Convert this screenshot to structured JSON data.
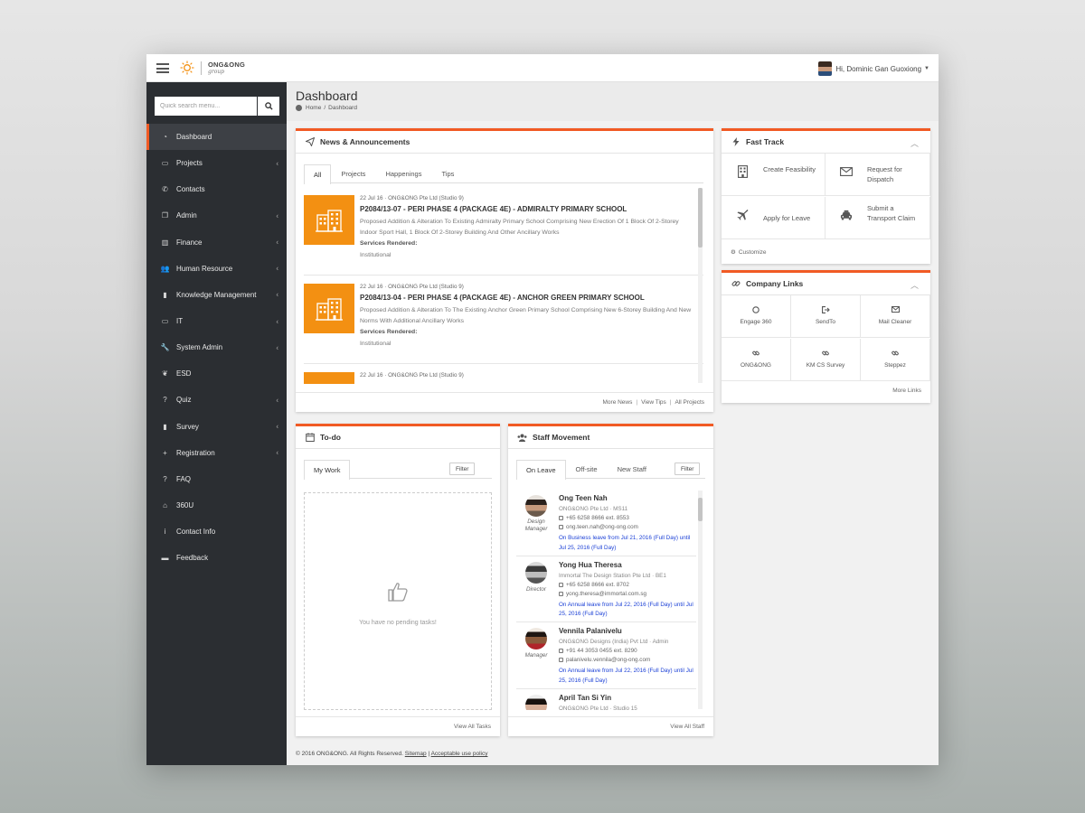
{
  "topbar": {
    "logo_text": "ONG&ONG",
    "logo_sub": "group",
    "user_greeting": "Hi, Dominic Gan Guoxiong"
  },
  "sidebar": {
    "search_placeholder": "Quick search menu...",
    "items": [
      {
        "label": "Dashboard",
        "icon": "dashboard-icon",
        "active": true,
        "chevron": false
      },
      {
        "label": "Projects",
        "icon": "folder-icon",
        "chevron": true
      },
      {
        "label": "Contacts",
        "icon": "phone-icon",
        "chevron": false
      },
      {
        "label": "Admin",
        "icon": "copy-icon",
        "chevron": true
      },
      {
        "label": "Finance",
        "icon": "bar-chart-icon",
        "chevron": true
      },
      {
        "label": "Human Resource",
        "icon": "users-icon",
        "chevron": true
      },
      {
        "label": "Knowledge Management",
        "icon": "book-icon",
        "chevron": true
      },
      {
        "label": "IT",
        "icon": "laptop-icon",
        "chevron": true
      },
      {
        "label": "System Admin",
        "icon": "wrench-icon",
        "chevron": true
      },
      {
        "label": "ESD",
        "icon": "leaf-icon",
        "chevron": false
      },
      {
        "label": "Quiz",
        "icon": "question-circle-icon",
        "chevron": true
      },
      {
        "label": "Survey",
        "icon": "book-icon",
        "chevron": true
      },
      {
        "label": "Registration",
        "icon": "plus-icon",
        "chevron": true
      },
      {
        "label": "FAQ",
        "icon": "question-icon",
        "chevron": false
      },
      {
        "label": "360U",
        "icon": "bank-icon",
        "chevron": false
      },
      {
        "label": "Contact Info",
        "icon": "info-circle-icon",
        "chevron": false
      },
      {
        "label": "Feedback",
        "icon": "comments-icon",
        "chevron": false
      }
    ]
  },
  "header": {
    "title": "Dashboard",
    "breadcrumb_home": "Home",
    "breadcrumb_sep": "/",
    "breadcrumb_current": "Dashboard"
  },
  "news": {
    "title": "News & Announcements",
    "tabs": [
      "All",
      "Projects",
      "Happenings",
      "Tips"
    ],
    "items": [
      {
        "meta": "22 Jul 16  ·  ONG&ONG Pte Ltd (Studio 9)",
        "title": "P2084/13-07 - PERI PHASE 4 (PACKAGE 4E) - ADMIRALTY PRIMARY SCHOOL",
        "desc": "Proposed Addition & Alteration To Existing Admiralty Primary School Comprising New Erection Of 1 Block Of 2-Storey Indoor Sport Hall, 1 Block Of 2-Storey Building And Other Ancillary Works",
        "services_label": "Services Rendered:",
        "services": "Institutional"
      },
      {
        "meta": "22 Jul 16  ·  ONG&ONG Pte Ltd (Studio 9)",
        "title": "P2084/13-04 - PERI PHASE 4 (PACKAGE 4E) - ANCHOR GREEN PRIMARY SCHOOL",
        "desc": "Proposed Addition & Alteration To The Existing Anchor Green Primary School Comprising New 6-Storey Building And New Norms With Additional Ancillary Works",
        "services_label": "Services Rendered:",
        "services": "Institutional"
      },
      {
        "meta": "22 Jul 16  ·  ONG&ONG Pte Ltd (Studio 9)",
        "title": "",
        "desc": "",
        "services_label": "",
        "services": ""
      }
    ],
    "footer": {
      "more_news": "More News",
      "view_tips": "View Tips",
      "all_projects": "All Projects",
      "sep": "|"
    }
  },
  "fasttrack": {
    "title": "Fast Track",
    "items": [
      {
        "label": "Create Feasibility",
        "icon": "building-icon"
      },
      {
        "label": "Request for Dispatch",
        "icon": "envelope-icon"
      },
      {
        "label": "Apply for Leave",
        "icon": "plane-icon"
      },
      {
        "label": "Submit a Transport Claim",
        "icon": "taxi-icon"
      }
    ],
    "customize": "Customize"
  },
  "links": {
    "title": "Company Links",
    "items": [
      {
        "label": "Engage 360",
        "icon": "circle-o-icon"
      },
      {
        "label": "SendTo",
        "icon": "sign-out-icon"
      },
      {
        "label": "Mail Cleaner",
        "icon": "envelope-icon"
      },
      {
        "label": "ONG&ONG",
        "icon": "link-icon"
      },
      {
        "label": "KM CS Survey",
        "icon": "link-icon"
      },
      {
        "label": "Steppez",
        "icon": "link-icon"
      }
    ],
    "more": "More Links"
  },
  "todo": {
    "title": "To-do",
    "tab": "My Work",
    "filter": "Filter",
    "empty": "You have no pending tasks!",
    "view_all": "View All Tasks"
  },
  "staff": {
    "title": "Staff Movement",
    "tabs": [
      "On Leave",
      "Off-site",
      "New Staff"
    ],
    "filter": "Filter",
    "people": [
      {
        "name": "Ong Teen Nah",
        "role": "Design Manager",
        "company": "ONG&ONG Pte Ltd · MS11",
        "phone": "+65 6258 8666 ext. 8553",
        "email": "ong.teen.nah@ong-ong.com",
        "leave": "On Business leave from Jul 21, 2016 (Full Day) until Jul 25, 2016 (Full Day)"
      },
      {
        "name": "Yong Hua Theresa",
        "role": "Director",
        "company": "Immortal The Design Station Pte Ltd · BE1",
        "phone": "+65 6258 8666 ext. 8702",
        "email": "yong.theresa@immortal.com.sg",
        "leave": "On Annual leave from Jul 22, 2016 (Full Day) until Jul 25, 2016 (Full Day)"
      },
      {
        "name": "Vennila Palanivelu",
        "role": "Manager",
        "company": "ONG&ONG Designs (India) Pvt Ltd · Admin",
        "phone": "+91 44 3053 0455 ext. 8290",
        "email": "palanivelu.vennila@ong-ong.com",
        "leave": "On Annual leave from Jul 22, 2016 (Full Day) until Jul 25, 2016 (Full Day)"
      },
      {
        "name": "April Tan Si Yin",
        "role": "",
        "company": "ONG&ONG Pte Ltd · Studio 15",
        "phone": "",
        "email": "",
        "leave": ""
      }
    ],
    "view_all": "View All Staff"
  },
  "footer": {
    "copyright": "© 2016 ONG&ONG. All Rights Reserved.",
    "sitemap": "Sitemap",
    "sep": "|",
    "policy": "Acceptable use policy"
  },
  "colors": {
    "accent": "#f15a24",
    "thumb": "#f39012",
    "sidebar": "#2b2e32",
    "leave_text": "#1a3fd6"
  }
}
